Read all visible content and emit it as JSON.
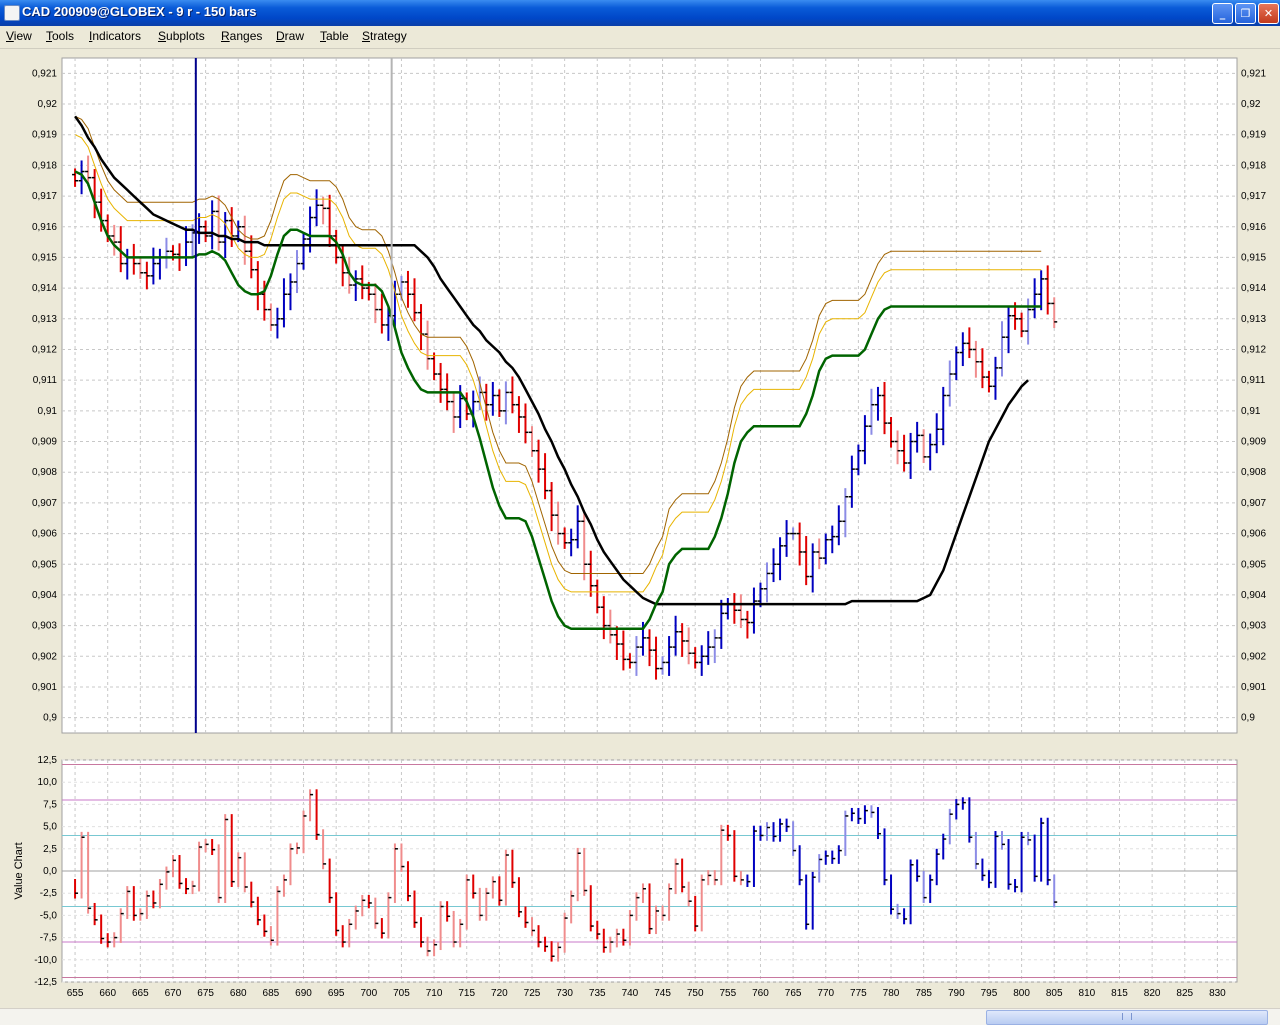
{
  "window": {
    "title": "CAD 200909@GLOBEX - 9 r - 150 bars",
    "buttons": [
      "_",
      "❐",
      "✕"
    ]
  },
  "menu": [
    "View",
    "Tools",
    "Indicators",
    "Subplots",
    "Ranges",
    "Draw",
    "Table",
    "Strategy"
  ],
  "colors": {
    "down_bar": "#e00000",
    "down_bar_light": "#f08c8c",
    "up_bar": "#0000c0",
    "up_bar_light": "#8c8ce6",
    "trend_line": "#006400",
    "slow_line": "#000000",
    "band_inner": "#e8b400",
    "band_outer": "#a06400",
    "cursor_line": "#00008b",
    "grid": "#c8c8c8"
  },
  "chart_data": [
    {
      "type": "ohlc",
      "name": "price",
      "xlim": [
        653,
        833
      ],
      "ylim": [
        0.8995,
        0.9215
      ],
      "x_ticks": [
        655,
        660,
        665,
        670,
        675,
        680,
        685,
        690,
        695,
        700,
        705,
        710,
        715,
        720,
        725,
        730,
        735,
        740,
        745,
        750,
        755,
        760,
        765,
        770,
        775,
        780,
        785,
        790,
        795,
        800,
        805,
        810,
        815,
        820,
        825,
        830
      ],
      "y_ticks": [
        "0,9",
        "0,901",
        "0,902",
        "0,903",
        "0,904",
        "0,905",
        "0,906",
        "0,907",
        "0,908",
        "0,909",
        "0,91",
        "0,911",
        "0,912",
        "0,913",
        "0,914",
        "0,915",
        "0,916",
        "0,917",
        "0,918",
        "0,919",
        "0,92",
        "0,921"
      ],
      "grid": true,
      "vertical_markers": [
        673.5,
        703.5
      ],
      "close": [
        0.9175,
        0.9178,
        0.9176,
        0.9168,
        0.9162,
        0.9157,
        0.9155,
        0.9148,
        0.915,
        0.9148,
        0.9145,
        0.9144,
        0.9148,
        0.915,
        0.9152,
        0.9151,
        0.915,
        0.9155,
        0.9158,
        0.916,
        0.9157,
        0.9165,
        0.9155,
        0.9162,
        0.9157,
        0.916,
        0.9152,
        0.9146,
        0.9138,
        0.9133,
        0.9128,
        0.913,
        0.9138,
        0.9142,
        0.9148,
        0.9156,
        0.9163,
        0.9167,
        0.9166,
        0.9157,
        0.915,
        0.9145,
        0.9141,
        0.9143,
        0.914,
        0.9138,
        0.9133,
        0.9128,
        0.9131,
        0.9138,
        0.9142,
        0.9138,
        0.9132,
        0.9125,
        0.9117,
        0.9112,
        0.9107,
        0.9103,
        0.9098,
        0.9104,
        0.9099,
        0.9103,
        0.9106,
        0.9102,
        0.9105,
        0.91,
        0.9106,
        0.9102,
        0.9098,
        0.9093,
        0.9087,
        0.9081,
        0.9074,
        0.9066,
        0.906,
        0.9057,
        0.9058,
        0.9064,
        0.905,
        0.9043,
        0.9036,
        0.903,
        0.9027,
        0.9024,
        0.9019,
        0.9018,
        0.9023,
        0.9026,
        0.9022,
        0.9016,
        0.9018,
        0.9023,
        0.9028,
        0.9025,
        0.9021,
        0.9018,
        0.902,
        0.9023,
        0.9026,
        0.9034,
        0.9037,
        0.9035,
        0.9032,
        0.9031,
        0.9038,
        0.9042,
        0.9047,
        0.905,
        0.9056,
        0.906,
        0.906,
        0.9054,
        0.9046,
        0.9054,
        0.9052,
        0.9058,
        0.9059,
        0.9064,
        0.9072,
        0.9081,
        0.9087,
        0.9095,
        0.9102,
        0.9105,
        0.9096,
        0.909,
        0.9087,
        0.9083,
        0.909,
        0.9092,
        0.9085,
        0.9089,
        0.9094,
        0.9105,
        0.9112,
        0.9119,
        0.9122,
        0.912,
        0.9116,
        0.9111,
        0.9108,
        0.9114,
        0.9124,
        0.9131,
        0.913,
        0.9126,
        0.9133,
        0.9138,
        0.9143,
        0.9135,
        0.9129
      ],
      "slow_line": [
        0.9196,
        0.9193,
        0.9189,
        0.9186,
        0.9182,
        0.9179,
        0.9176,
        0.9174,
        0.9172,
        0.917,
        0.9168,
        0.9166,
        0.9164,
        0.9163,
        0.9162,
        0.9161,
        0.916,
        0.9159,
        0.9159,
        0.9158,
        0.9158,
        0.9158,
        0.9157,
        0.9157,
        0.9156,
        0.9156,
        0.9155,
        0.9155,
        0.9155,
        0.9154,
        0.9154,
        0.9154,
        0.9154,
        0.9154,
        0.9154,
        0.9154,
        0.9154,
        0.9154,
        0.9154,
        0.9154,
        0.9154,
        0.9154,
        0.9154,
        0.9154,
        0.9154,
        0.9154,
        0.9154,
        0.9154,
        0.9154,
        0.9154,
        0.9154,
        0.9154,
        0.9154,
        0.9152,
        0.915,
        0.9147,
        0.9143,
        0.914,
        0.9137,
        0.9134,
        0.9131,
        0.9128,
        0.9126,
        0.9123,
        0.9121,
        0.9119,
        0.9116,
        0.9114,
        0.9111,
        0.9107,
        0.9103,
        0.9099,
        0.9094,
        0.909,
        0.9085,
        0.9081,
        0.9076,
        0.9072,
        0.9067,
        0.9063,
        0.9058,
        0.9054,
        0.9051,
        0.9048,
        0.9045,
        0.9043,
        0.9041,
        0.9039,
        0.9038,
        0.9037,
        0.9037,
        0.9037,
        0.9037,
        0.9037,
        0.9037,
        0.9037,
        0.9037,
        0.9037,
        0.9037,
        0.9037,
        0.9037,
        0.9037,
        0.9037,
        0.9037,
        0.9037,
        0.9037,
        0.9037,
        0.9037,
        0.9037,
        0.9037,
        0.9037,
        0.9037,
        0.9037,
        0.9037,
        0.9037,
        0.9037,
        0.9037,
        0.9037,
        0.9037,
        0.9038,
        0.9038,
        0.9038,
        0.9038,
        0.9038,
        0.9038,
        0.9038,
        0.9038,
        0.9038,
        0.9038,
        0.9038,
        0.9039,
        0.904,
        0.9044,
        0.9048,
        0.9054,
        0.906,
        0.9066,
        0.9072,
        0.9078,
        0.9084,
        0.909,
        0.9094,
        0.9098,
        0.9102,
        0.9105,
        0.9108,
        0.911
      ],
      "trend_line": [
        0.9178,
        0.9177,
        0.9174,
        0.9168,
        0.9162,
        0.9157,
        0.9154,
        0.9152,
        0.915,
        0.915,
        0.915,
        0.915,
        0.915,
        0.915,
        0.915,
        0.915,
        0.915,
        0.915,
        0.915,
        0.9151,
        0.9151,
        0.9152,
        0.9151,
        0.9149,
        0.9145,
        0.9141,
        0.9139,
        0.9138,
        0.9138,
        0.9139,
        0.9144,
        0.9151,
        0.9157,
        0.9159,
        0.9159,
        0.9158,
        0.9157,
        0.9157,
        0.9157,
        0.9157,
        0.9155,
        0.9151,
        0.9145,
        0.9142,
        0.9141,
        0.9141,
        0.9141,
        0.9139,
        0.9134,
        0.9127,
        0.9119,
        0.9114,
        0.911,
        0.9107,
        0.9106,
        0.9106,
        0.9106,
        0.9106,
        0.9106,
        0.9106,
        0.9103,
        0.9098,
        0.9091,
        0.9083,
        0.9075,
        0.9069,
        0.9065,
        0.9065,
        0.9065,
        0.9064,
        0.9059,
        0.9052,
        0.9045,
        0.9038,
        0.9033,
        0.903,
        0.9029,
        0.9029,
        0.9029,
        0.9029,
        0.9029,
        0.9029,
        0.9029,
        0.9029,
        0.9029,
        0.9029,
        0.9029,
        0.9029,
        0.9032,
        0.9037,
        0.9041,
        0.905,
        0.9053,
        0.9055,
        0.9055,
        0.9055,
        0.9055,
        0.9055,
        0.9059,
        0.9065,
        0.9073,
        0.9083,
        0.909,
        0.9093,
        0.9095,
        0.9095,
        0.9095,
        0.9095,
        0.9095,
        0.9095,
        0.9095,
        0.9095,
        0.9099,
        0.9105,
        0.9113,
        0.9117,
        0.9118,
        0.9118,
        0.9118,
        0.9118,
        0.9118,
        0.912,
        0.9125,
        0.913,
        0.9133,
        0.9134,
        0.9134,
        0.9134,
        0.9134,
        0.9134,
        0.9134,
        0.9134,
        0.9134,
        0.9134,
        0.9134,
        0.9134,
        0.9134,
        0.9134,
        0.9134,
        0.9134,
        0.9134,
        0.9134,
        0.9134,
        0.9134,
        0.9134,
        0.9134,
        0.9134,
        0.9134,
        0.9134
      ],
      "band_inner_upper_offset": 0.0012,
      "band_outer_upper_offset": 0.0018
    },
    {
      "type": "ohlc",
      "name": "value",
      "ylabel": "Value Chart",
      "ylim": [
        -12.5,
        12.5
      ],
      "y_ticks": [
        "-12,5",
        "-10,0",
        "-7,5",
        "-5,0",
        "-2,5",
        "0,0",
        "2,5",
        "5,0",
        "7,5",
        "10,0",
        "12,5"
      ],
      "ref_lines": [
        {
          "value": 12.0,
          "color": "#c878a0"
        },
        {
          "value": 8.0,
          "color": "#c878c8"
        },
        {
          "value": 4.0,
          "color": "#78c8d2"
        },
        {
          "value": 0.0,
          "color": "#a0a0a0"
        },
        {
          "value": -4.0,
          "color": "#78c8d2"
        },
        {
          "value": -8.0,
          "color": "#c878c8"
        },
        {
          "value": -12.0,
          "color": "#c878a0"
        }
      ],
      "values": [
        -2.5,
        3.8,
        -4.2,
        -5.5,
        -7.6,
        -8.0,
        -7.5,
        -4.8,
        -2.3,
        -5.0,
        -4.8,
        -2.8,
        -3.6,
        -1.5,
        -0.1,
        1.2,
        -1.4,
        -2.0,
        -1.7,
        2.7,
        3.0,
        2.4,
        -3.0,
        5.8,
        -1.2,
        1.5,
        -1.8,
        -3.5,
        -5.5,
        -6.8,
        -7.8,
        -2.3,
        -1.0,
        2.5,
        2.6,
        6.2,
        8.6,
        4.1,
        0.8,
        -3.0,
        -6.7,
        -8.0,
        -6.0,
        -4.5,
        -3.3,
        -3.6,
        -5.9,
        -7.0,
        -3.0,
        2.5,
        0.5,
        -2.8,
        -5.8,
        -8.0,
        -9.0,
        -8.3,
        -4.0,
        -5.1,
        -8.0,
        -6.0,
        -1.0,
        -2.5,
        -5.0,
        -2.5,
        -1.2,
        -3.3,
        1.8,
        -1.3,
        -4.6,
        -5.8,
        -6.7,
        -8.0,
        -8.5,
        -9.6,
        -8.6,
        -5.3,
        -2.8,
        2.0,
        -2.2,
        -6.2,
        -7.1,
        -8.6,
        -8.0,
        -7.1,
        -7.8,
        -5.0,
        -3.0,
        -2.0,
        -6.5,
        -4.5,
        -5.0,
        -2.0,
        0.8,
        -1.8,
        -3.4,
        -6.2,
        -1.0,
        -0.5,
        -1.0,
        4.6,
        4.0,
        -0.6,
        -1.0,
        -1.2,
        4.5,
        4.0,
        4.9,
        3.9,
        5.3,
        5.0,
        2.3,
        -1.0,
        -6.0,
        -0.7,
        1.3,
        1.7,
        1.4,
        2.3,
        6.2,
        6.5,
        5.9,
        6.8,
        6.6,
        4.2,
        -1.0,
        -4.3,
        -4.8,
        -5.4,
        0.7,
        -0.6,
        -3.0,
        -1.0,
        1.9,
        3.6,
        6.4,
        7.5,
        7.7,
        3.8,
        0.8,
        -0.5,
        -1.3,
        3.9,
        3.0,
        -1.5,
        -1.8,
        3.8,
        3.5,
        -0.6,
        5.4,
        -1.0,
        -3.5
      ],
      "x_axis_ticks": [
        655,
        660,
        665,
        670,
        675,
        680,
        685,
        690,
        695,
        700,
        705,
        710,
        715,
        720,
        725,
        730,
        735,
        740,
        745,
        750,
        755,
        760,
        765,
        770,
        775,
        780,
        785,
        790,
        795,
        800,
        805,
        810,
        815,
        820,
        825,
        830
      ]
    }
  ]
}
